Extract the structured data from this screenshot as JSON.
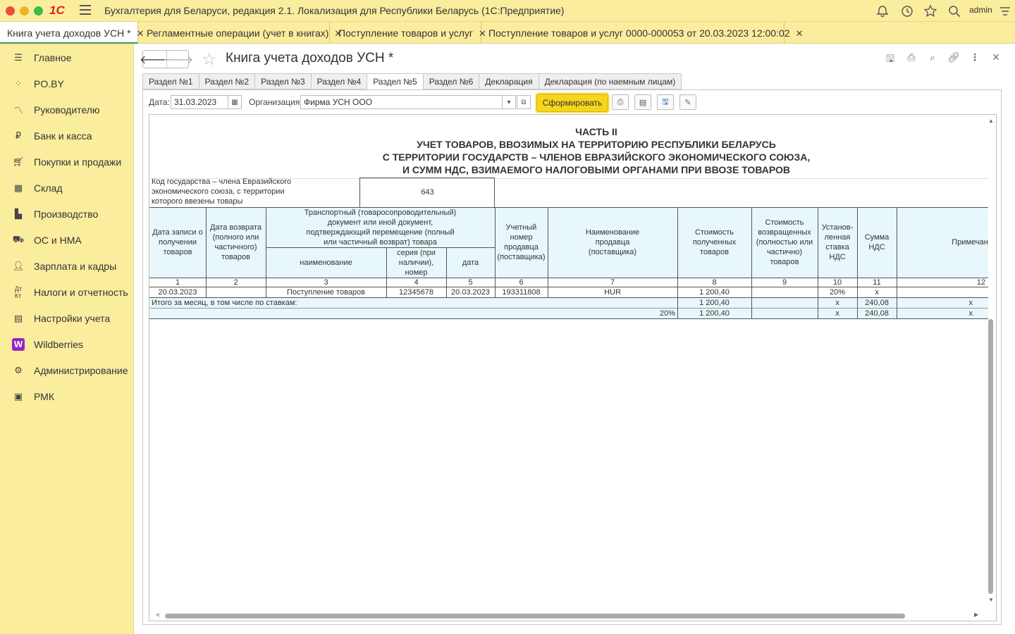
{
  "titlebar": {
    "app_title": "Бухгалтерия для Беларуси, редакция 2.1. Локализация для Республики Беларусь   (1С:Предприятие)",
    "logo": "1С",
    "user": "admin"
  },
  "open_tabs": [
    {
      "label": "Книга учета доходов УСН *"
    },
    {
      "label": "Регламентные операции (учет в книгах)"
    },
    {
      "label": "Поступление товаров и услуг"
    },
    {
      "label": "Поступление товаров и услуг 0000-000053 от 20.03.2023 12:00:02"
    }
  ],
  "sidebar": {
    "items": [
      {
        "label": "Главное",
        "icon": "menu-icon"
      },
      {
        "label": "PO.BY",
        "icon": "poby-icon"
      },
      {
        "label": "Руководителю",
        "icon": "chart-icon"
      },
      {
        "label": "Банк и касса",
        "icon": "ruble-icon"
      },
      {
        "label": "Покупки и продажи",
        "icon": "cart-icon"
      },
      {
        "label": "Склад",
        "icon": "warehouse-icon"
      },
      {
        "label": "Производство",
        "icon": "factory-icon"
      },
      {
        "label": "ОС и НМА",
        "icon": "truck-icon"
      },
      {
        "label": "Зарплата и кадры",
        "icon": "person-icon"
      },
      {
        "label": "Налоги и отчетность",
        "icon": "dt-kt-icon"
      },
      {
        "label": "Настройки учета",
        "icon": "book-icon"
      },
      {
        "label": "Wildberries",
        "icon": "wildberries-icon"
      },
      {
        "label": "Администрирование",
        "icon": "gear-icon"
      },
      {
        "label": "РМК",
        "icon": "cash-register-icon"
      }
    ]
  },
  "document": {
    "title": "Книга учета доходов УСН *",
    "section_tabs": [
      "Раздел №1",
      "Раздел №2",
      "Раздел №3",
      "Раздел №4",
      "Раздел №5",
      "Раздел №6",
      "Декларация",
      "Декларация (по наемным лицам)"
    ],
    "active_section": "Раздел №5",
    "date_label": "Дата:",
    "date_value": "31.03.2023",
    "org_label": "Организация:",
    "org_value": "Фирма УСН ООО",
    "generate_button": "Сформировать"
  },
  "report": {
    "part": "ЧАСТЬ II",
    "title_lines": [
      "УЧЕТ ТОВАРОВ, ВВОЗИМЫХ НА ТЕРРИТОРИЮ РЕСПУБЛИКИ БЕЛАРУСЬ",
      "С ТЕРРИТОРИИ ГОСУДАРСТВ – ЧЛЕНОВ ЕВРАЗИЙСКОГО ЭКОНОМИЧЕСКОГО СОЮЗА,",
      "И СУММ НДС, ВЗИМАЕМОГО НАЛОГОВЫМИ ОРГАНАМИ ПРИ ВВОЗЕ ТОВАРОВ"
    ],
    "country_label_lines": [
      "Код государства – члена Евразийского",
      "экономического союза, с территории",
      "которого ввезены товары"
    ],
    "country_code": "643",
    "headers": {
      "c1": "Дата записи о получении товаров",
      "c2": "Дата возврата (полного или частичного) товаров",
      "transport": "Транспортный (товаросопроводительный) документ или иной документ, подтверждающий перемещение (полный или частичный возврат) товара",
      "c3": "наименование",
      "c4": "серия (при наличии), номер",
      "c5": "дата",
      "c6": "Учетный номер продавца (поставщика)",
      "c7": "Наименование продавца (поставщика)",
      "c8": "Стоимость полученных товаров",
      "c9": "Стоимость возвращенных (полностью или частично) товаров",
      "c10": "Установ-ленная ставка НДС",
      "c11": "Сумма НДС",
      "c12": "Примечан"
    },
    "col_numbers": [
      "1",
      "2",
      "3",
      "4",
      "5",
      "6",
      "7",
      "8",
      "9",
      "10",
      "11",
      "12"
    ],
    "row": {
      "c1": "20.03.2023",
      "c2": "",
      "c3": "Поступление товаров",
      "c4": "12345678",
      "c5": "20.03.2023",
      "c6": "193311808",
      "c7": "HUR",
      "c8": "1 200,40",
      "c9": "",
      "c10": "20%",
      "c11": "x",
      "c12": ""
    },
    "total": {
      "label": "Итого за месяц, в том числе по ставкам:",
      "c8": "1 200,40",
      "c9": "",
      "c10": "x",
      "c11": "240,08",
      "c12": "x"
    },
    "total_rate": {
      "rate": "20%",
      "c8": "1 200,40",
      "c9": "",
      "c10": "x",
      "c11": "240,08",
      "c12": "x"
    }
  }
}
